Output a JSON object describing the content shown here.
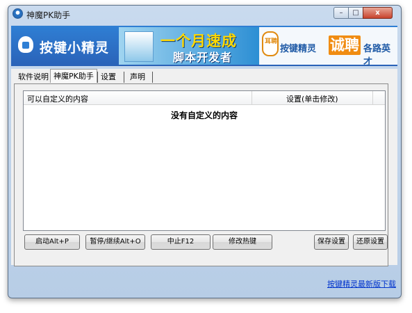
{
  "window": {
    "title": "神魔PK助手"
  },
  "title_buttons": {
    "minimize": "–",
    "maximize": "□",
    "close": "x"
  },
  "banner": {
    "brand": "按键小精灵",
    "ad1_line1": "一个月速成",
    "ad1_line2": "脚本开发者",
    "ad2_badge": "耳聘",
    "ad2_text1": "按键精灵",
    "ad2_text2": "诚聘",
    "ad2_text3": "各路英才"
  },
  "tabs": [
    {
      "label": "软件说明"
    },
    {
      "label": "神魔PK助手",
      "active": true
    },
    {
      "label": "设置"
    },
    {
      "label": "声明"
    }
  ],
  "list": {
    "columns": [
      "可以自定义的内容",
      "设置(单击修改)"
    ],
    "empty_text": "没有自定义的内容"
  },
  "buttons": {
    "start": "启动Alt+P",
    "pause": "暂停/继续Alt+O",
    "stop": "中止F12",
    "hotkey": "修改热键",
    "save": "保存设置",
    "restore": "还原设置"
  },
  "footer": {
    "link": "按键精灵最新版下载"
  }
}
